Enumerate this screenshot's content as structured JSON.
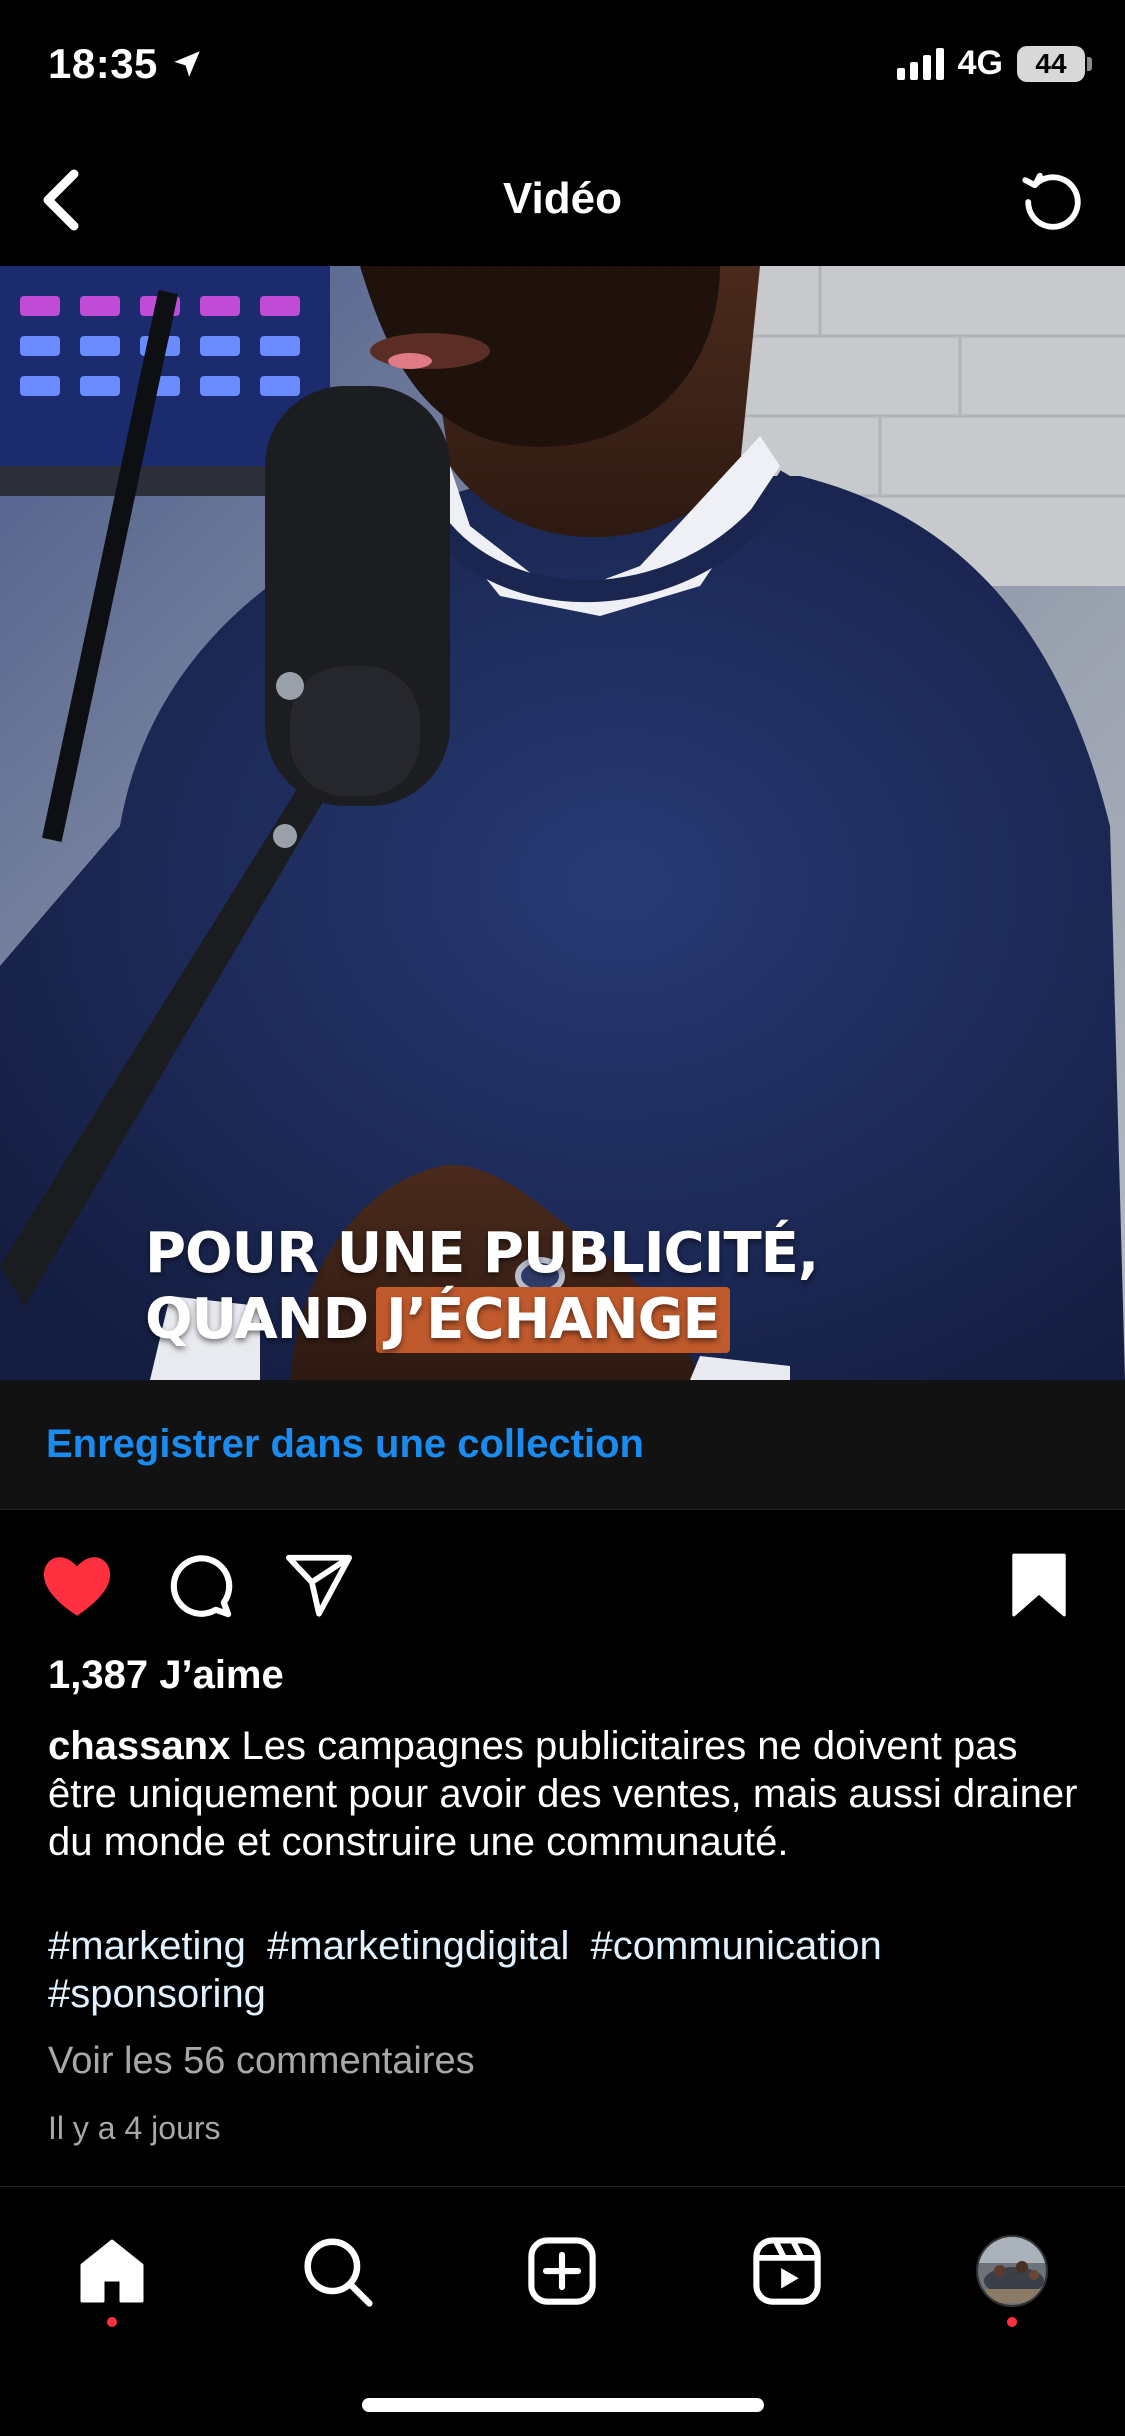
{
  "status_bar": {
    "time": "18:35",
    "network": "4G",
    "battery": "44"
  },
  "header": {
    "title": "Vidéo"
  },
  "video": {
    "caption_line1": "POUR UNE PUBLICITÉ,",
    "caption_line2_plain": "QUAND",
    "caption_line2_highlight": "J’ÉCHANGE",
    "highlight_color": "#c05a2d"
  },
  "collection": {
    "link_label": "Enregistrer dans une collection",
    "link_color": "#1a8cf0"
  },
  "actions": {
    "liked": true,
    "saved": true,
    "like_color": "#ff3040"
  },
  "post": {
    "likes": "1,387 J’aime",
    "username": "chassanx",
    "caption": "Les campagnes publicitaires ne doivent pas être uniquement pour avoir des ventes, mais aussi drainer du monde et construire une communauté.",
    "hashtags": [
      "#marketing",
      "#marketingdigital",
      "#communication",
      "#sponsoring"
    ],
    "comments_link": "Voir les 56 commentaires",
    "timestamp": "Il y a 4 jours"
  },
  "tabbar": {
    "items": [
      {
        "name": "home-icon",
        "active": true,
        "notification_dot": true
      },
      {
        "name": "search-icon",
        "active": false,
        "notification_dot": false
      },
      {
        "name": "create-icon",
        "active": false,
        "notification_dot": false
      },
      {
        "name": "reels-icon",
        "active": false,
        "notification_dot": false
      },
      {
        "name": "profile-avatar",
        "active": false,
        "notification_dot": true
      }
    ]
  }
}
